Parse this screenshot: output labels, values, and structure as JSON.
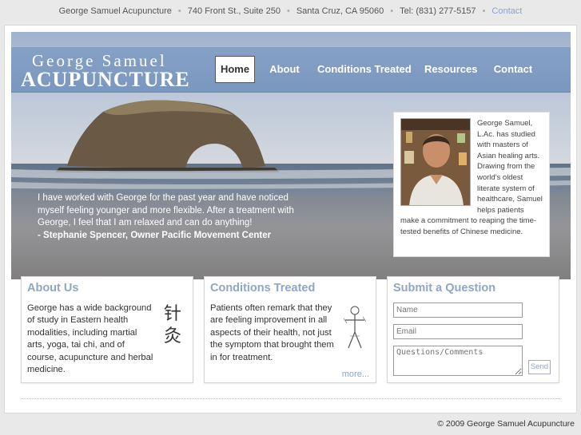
{
  "topbar": {
    "name": "George Samuel Acupuncture",
    "address": "740 Front St., Suite 250",
    "city": "Santa Cruz, CA 95060",
    "phone": "Tel: (831) 277-5157",
    "contact": "Contact"
  },
  "logo": {
    "line1": "George Samuel",
    "line2": "ACUPUNCTURE"
  },
  "nav": {
    "items": [
      {
        "label": "Home",
        "active": true
      },
      {
        "label": "About"
      },
      {
        "label": "Conditions Treated"
      },
      {
        "label": "Resources"
      },
      {
        "label": "Contact"
      }
    ]
  },
  "hero": {
    "quote": "I have worked with George for the past year and have noticed myself feeling younger and more flexible. After a treatment with George, I feel that I am relaxed and can do anything!",
    "author": "- Stephanie Spencer, Owner Pacific Movement Center",
    "bio": "George Samuel, L.Ac. has studied with masters of Asian healing arts. Drawing from the world's oldest literate system of healthcare, Samuel helps patients make a commitment to reaping the time-tested benefits of Chinese medicine."
  },
  "about": {
    "title": "About Us",
    "text": "George has a wide background of study in Eastern health modalities, including martial arts, yoga, tai chi, and of course, acupuncture and herbal medicine.",
    "glyph1": "针",
    "glyph2": "灸"
  },
  "conditions": {
    "title": "Conditions Treated",
    "text": "Patients often remark that they are feeling improvement in all aspects of their health, not just the symptom that brought them in for treatment.",
    "more": "more..."
  },
  "question": {
    "title": "Submit a Question",
    "name_placeholder": "Name",
    "email_placeholder": "Email",
    "comments_placeholder": "Questions/Comments",
    "send": "Send"
  },
  "footer": {
    "copyright": "© 2009 George Samuel Acupuncture"
  },
  "colors": {
    "nav_blue": "#7e9bc2",
    "heading_blue": "#8fa6c6",
    "link_blue": "#8aa5c8"
  }
}
